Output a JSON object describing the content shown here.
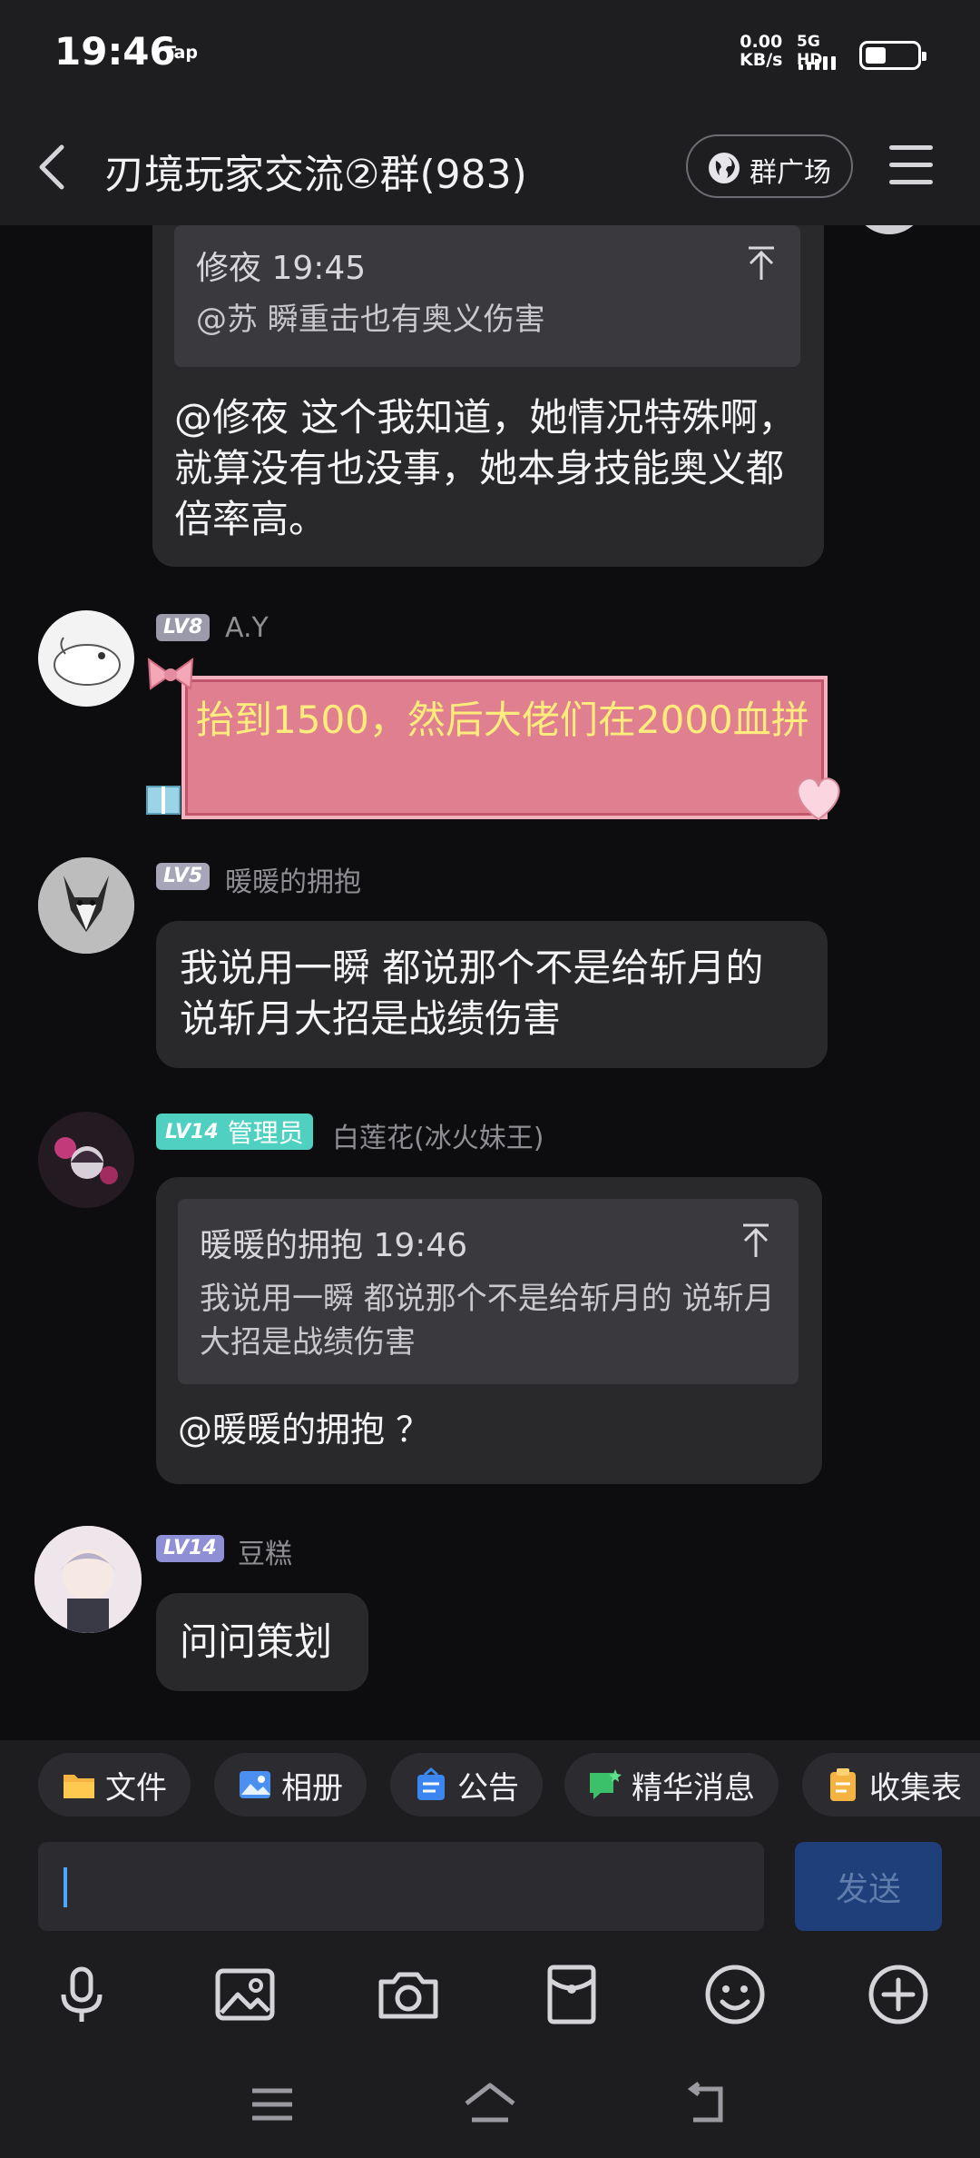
{
  "status_bar": {
    "time": "19:46",
    "tap": "Tap",
    "net_speed": "0.00",
    "net_unit": "KB/s",
    "signal_label": "5G HD",
    "battery_level": 0.4
  },
  "header": {
    "title": "刃境玩家交流②群(983)",
    "square_label": "群广场"
  },
  "messages": {
    "m1": {
      "quote_author_time": "修夜 19:45",
      "quote_text": "@苏 瞬重击也有奥义伤害",
      "text": "@修夜 这个我知道，她情况特殊啊，就算没有也没事，她本身技能奥义都倍率高。"
    },
    "m2": {
      "level": "LV8",
      "user": "A.Y",
      "text": "抬到1500，然后大佬们在2000血拼"
    },
    "m3": {
      "level": "LV5",
      "user": "暖暖的拥抱",
      "text": "我说用一瞬 都说那个不是给斩月的 说斩月大招是战绩伤害"
    },
    "m4": {
      "level": "LV14",
      "role": "管理员",
      "user": "白莲花(冰火妹王)",
      "quote_author_time": "暖暖的拥抱 19:46",
      "quote_text": "我说用一瞬 都说那个不是给斩月的 说斩月大招是战绩伤害",
      "text": "@暖暖的拥抱 ？"
    },
    "m5": {
      "level": "LV14",
      "user": "豆糕",
      "text": "问问策划"
    }
  },
  "quick_tabs": [
    "文件",
    "相册",
    "公告",
    "精华消息",
    "收集表"
  ],
  "input": {
    "placeholder": "",
    "send_label": "发送"
  },
  "colors": {
    "accent": "#4aa8ff",
    "admin_tag": "#4fd0c0",
    "pink_bubble": "#df7f8f",
    "pink_text": "#ffec7c"
  }
}
